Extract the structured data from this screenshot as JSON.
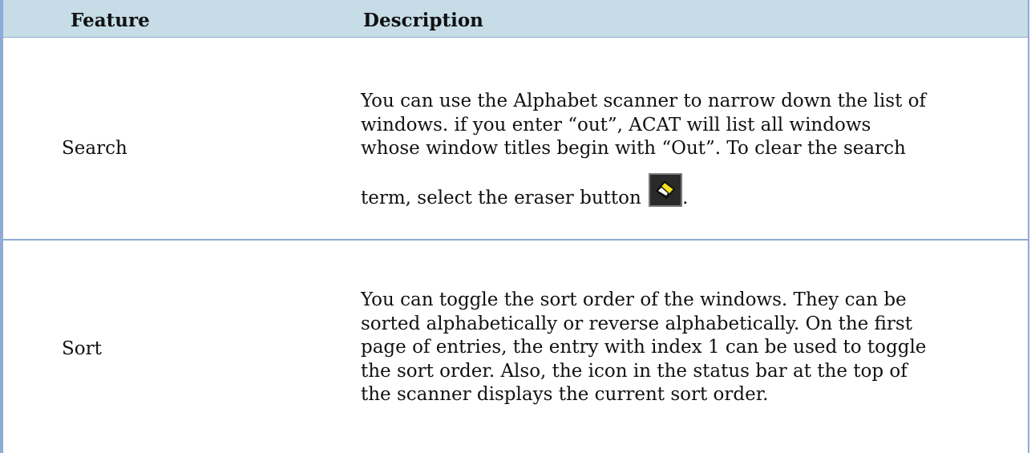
{
  "table": {
    "headers": {
      "feature": "Feature",
      "description": "Description"
    },
    "rows": [
      {
        "feature": "Search",
        "description_lines": [
          "You can use the Alphabet scanner to narrow down the list of",
          "windows.  if you enter “out”, ACAT will list all windows",
          "whose window titles begin with “Out”.  To clear the search",
          "term, select the eraser button"
        ],
        "description_end": ".",
        "icon": "eraser-icon"
      },
      {
        "feature": "Sort",
        "description_lines": [
          "You can toggle the sort order of the windows.  They can be",
          "sorted alphabetically or reverse alphabetically. On the first",
          "page of entries, the entry with index 1 can be used to toggle",
          "the sort order.  Also, the icon in the status bar at the top of",
          "the scanner displays the current sort order."
        ]
      }
    ]
  },
  "colors": {
    "header_bg": "#c6dde8",
    "border": "#8eaad6",
    "eraser_yellow": "#f5e21a"
  }
}
